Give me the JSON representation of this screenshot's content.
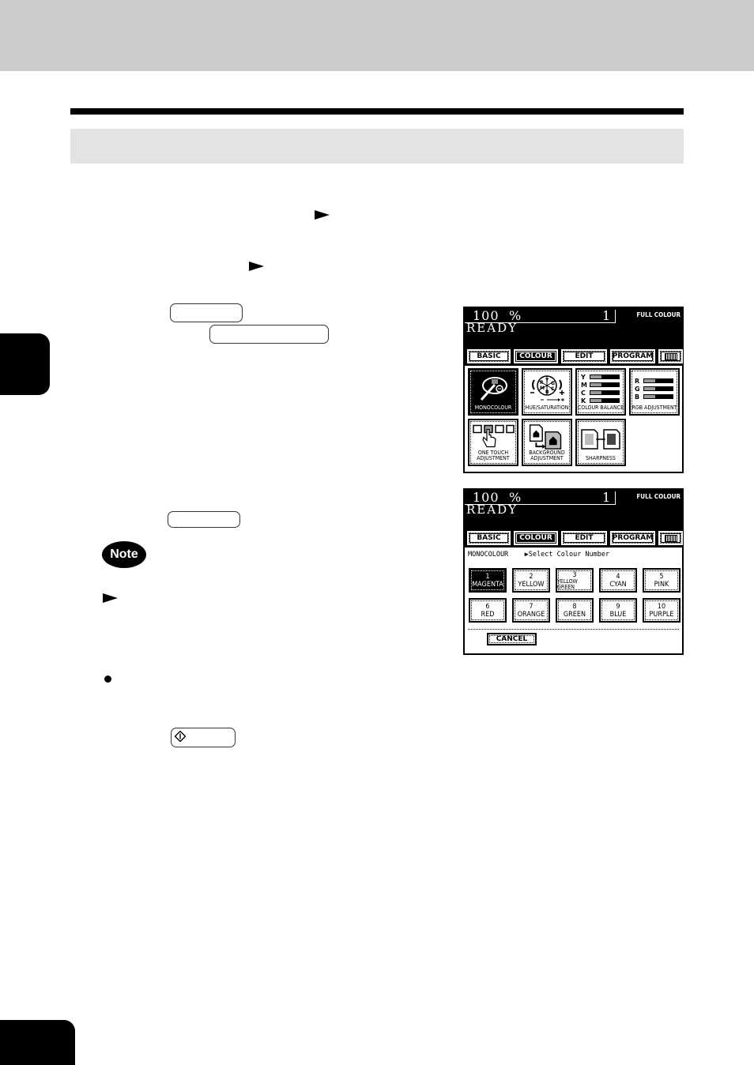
{
  "panel1": {
    "zoom": "100",
    "percent_sign": "%",
    "copies": "1",
    "mode": "FULL COLOUR",
    "status": "READY",
    "tabs": [
      {
        "label": "BASIC",
        "active": false
      },
      {
        "label": "COLOUR",
        "active": true
      },
      {
        "label": "EDIT",
        "active": false
      },
      {
        "label": "PROGRAM",
        "active": false
      },
      {
        "label": "keyboard-icon",
        "active": false
      }
    ],
    "functions": [
      {
        "label": "MONOCOLOUR",
        "icon": "palette-icon",
        "active": true
      },
      {
        "label": "HUE/SATURATION",
        "icon": "colour-wheel-icon",
        "active": false
      },
      {
        "label": "COLOUR BALANCE",
        "icon": "ymck-bars-icon",
        "active": false
      },
      {
        "label": "RGB ADJUSTMENT",
        "icon": "rgb-bars-icon",
        "active": false
      },
      {
        "label": "ONE TOUCH ADJUSTMENT",
        "icon": "finger-press-icon",
        "active": false
      },
      {
        "label": "BACKGROUND ADJUSTMENT",
        "icon": "background-document-icon",
        "active": false
      },
      {
        "label": "SHARPNESS",
        "icon": "sharpness-icon",
        "active": false
      }
    ],
    "wheel_letters": [
      "Y",
      "G",
      "C",
      "B",
      "M",
      "R"
    ],
    "balance_letters": [
      "Y",
      "M",
      "C",
      "K"
    ],
    "rgb_letters": [
      "R",
      "G",
      "B"
    ]
  },
  "panel2": {
    "zoom": "100",
    "percent_sign": "%",
    "copies": "1",
    "mode": "FULL COLOUR",
    "status": "READY",
    "tabs": [
      {
        "label": "BASIC",
        "active": false
      },
      {
        "label": "COLOUR",
        "active": true
      },
      {
        "label": "EDIT",
        "active": false
      },
      {
        "label": "PROGRAM",
        "active": false
      },
      {
        "label": "keyboard-icon",
        "active": false
      }
    ],
    "section_label": "MONOCOLOUR",
    "instruction": "▶Select Colour Number",
    "colours": [
      {
        "number": "1",
        "name": "MAGENTA",
        "active": true
      },
      {
        "number": "2",
        "name": "YELLOW",
        "active": false
      },
      {
        "number": "3",
        "name": "YELLOW GREEN",
        "active": false
      },
      {
        "number": "4",
        "name": "CYAN",
        "active": false
      },
      {
        "number": "5",
        "name": "PINK",
        "active": false
      },
      {
        "number": "6",
        "name": "RED",
        "active": false
      },
      {
        "number": "7",
        "name": "ORANGE",
        "active": false
      },
      {
        "number": "8",
        "name": "GREEN",
        "active": false
      },
      {
        "number": "9",
        "name": "BLUE",
        "active": false
      },
      {
        "number": "10",
        "name": "PURPLE",
        "active": false
      }
    ],
    "cancel_label": "CANCEL"
  },
  "note_label": "Note",
  "colors": {
    "header_band": "#cccccc",
    "title_band": "#e3e3e5",
    "ink": "#000000"
  }
}
